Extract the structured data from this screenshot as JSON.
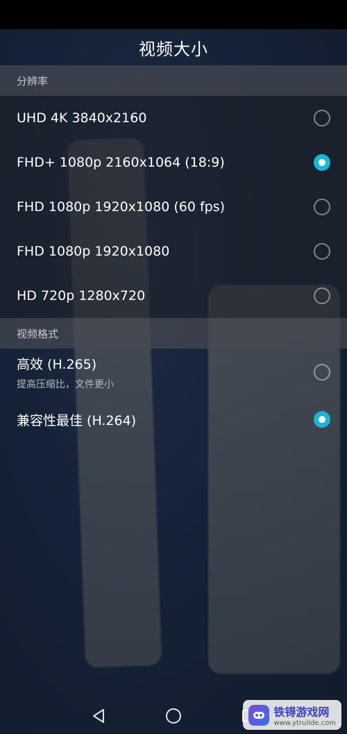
{
  "title": "视频大小",
  "sections": {
    "resolution": {
      "header": "分辨率",
      "options": [
        {
          "label": "UHD 4K 3840x2160",
          "checked": false
        },
        {
          "label": "FHD+ 1080p 2160x1064 (18:9)",
          "checked": true
        },
        {
          "label": "FHD 1080p 1920x1080 (60 fps)",
          "checked": false
        },
        {
          "label": "FHD 1080p 1920x1080",
          "checked": false
        },
        {
          "label": "HD 720p 1280x720",
          "checked": false
        }
      ]
    },
    "format": {
      "header": "视频格式",
      "options": [
        {
          "label": "高效 (H.265)",
          "sub": "提高压缩比，文件更小",
          "checked": false
        },
        {
          "label": "兼容性最佳 (H.264)",
          "checked": true
        }
      ]
    }
  },
  "colors": {
    "accent": "#1ab6d4"
  },
  "navbar": {
    "icons": [
      "back-icon",
      "home-icon",
      "recents-icon"
    ]
  },
  "watermark": {
    "title": "铁锝游戏网",
    "url": "www.ytruilde.com"
  }
}
